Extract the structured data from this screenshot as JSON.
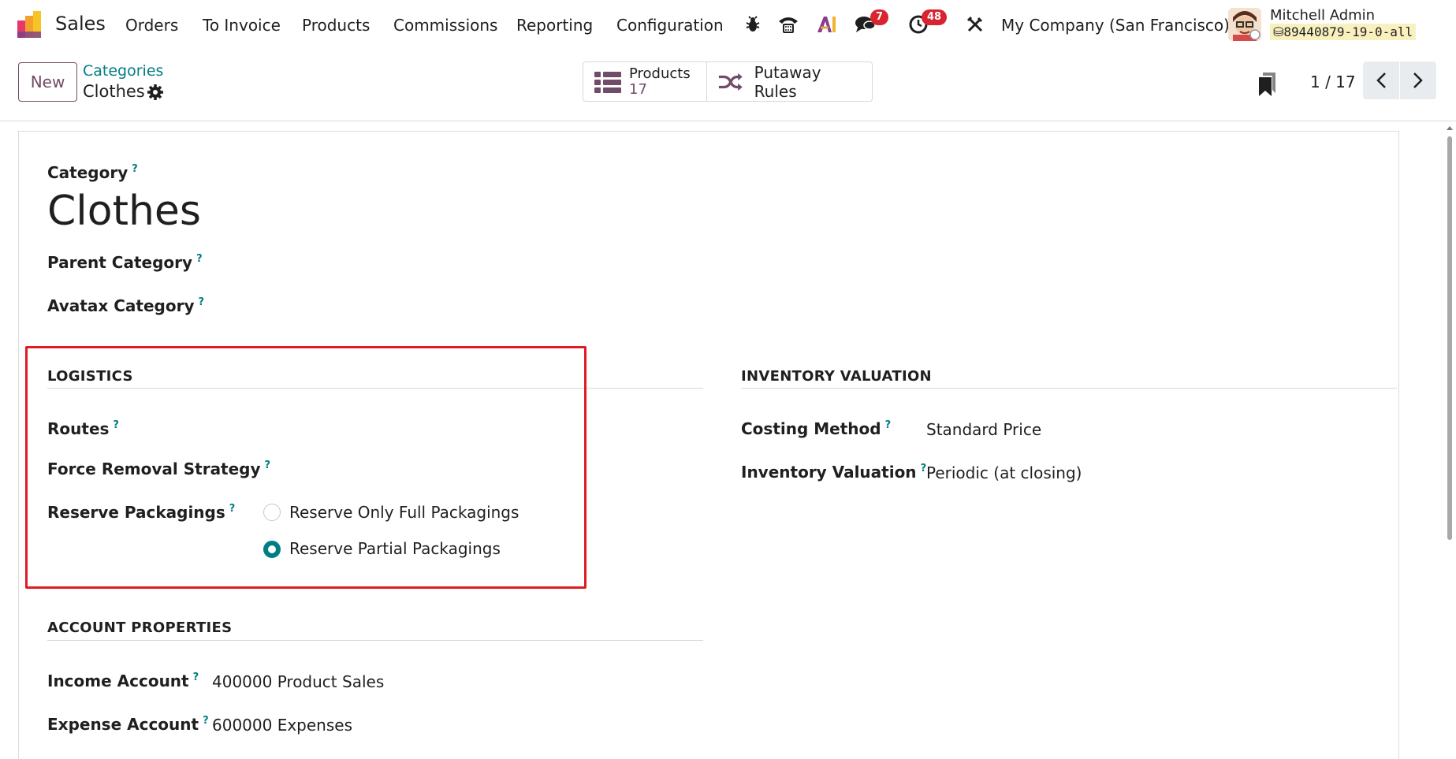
{
  "navbar": {
    "app_name": "Sales",
    "menu": [
      "Orders",
      "To Invoice",
      "Products",
      "Commissions",
      "Reporting",
      "Configuration"
    ],
    "messages_badge": "7",
    "activities_badge": "48",
    "company": "My Company (San Francisco)",
    "user_name": "Mitchell Admin",
    "db_name": "89440879-19-0-all",
    "icons": [
      "bug-icon",
      "phone-icon",
      "ai-icon",
      "chat-icon",
      "clock-icon",
      "tools-icon"
    ]
  },
  "control": {
    "new_label": "New",
    "breadcrumb_parent": "Categories",
    "breadcrumb_current": "Clothes",
    "smart_buttons": {
      "products_label": "Products",
      "products_count": "17",
      "putaway_label": "Putaway Rules"
    },
    "pager": "1 / 17"
  },
  "form": {
    "category_label": "Category",
    "category_name": "Clothes",
    "parent_category_label": "Parent Category",
    "avatax_category_label": "Avatax Category",
    "help_mark": "?",
    "logistics": {
      "heading": "LOGISTICS",
      "routes_label": "Routes",
      "removal_label": "Force Removal Strategy",
      "packagings_label": "Reserve Packagings",
      "options": [
        {
          "label": "Reserve Only Full Packagings",
          "checked": false
        },
        {
          "label": "Reserve Partial Packagings",
          "checked": true
        }
      ]
    },
    "inventory_valuation": {
      "heading": "INVENTORY VALUATION",
      "costing_label": "Costing Method",
      "costing_value": "Standard Price",
      "valuation_label": "Inventory Valuation",
      "valuation_value": "Periodic (at closing)"
    },
    "account_properties": {
      "heading": "ACCOUNT PROPERTIES",
      "income_label": "Income Account",
      "income_value": "400000 Product Sales",
      "expense_label": "Expense Account",
      "expense_value": "600000 Expenses"
    }
  },
  "colors": {
    "brand": "#714b67",
    "accent_teal": "#017e84",
    "badge_red": "#d9232e",
    "highlight_red": "#e01b24"
  }
}
